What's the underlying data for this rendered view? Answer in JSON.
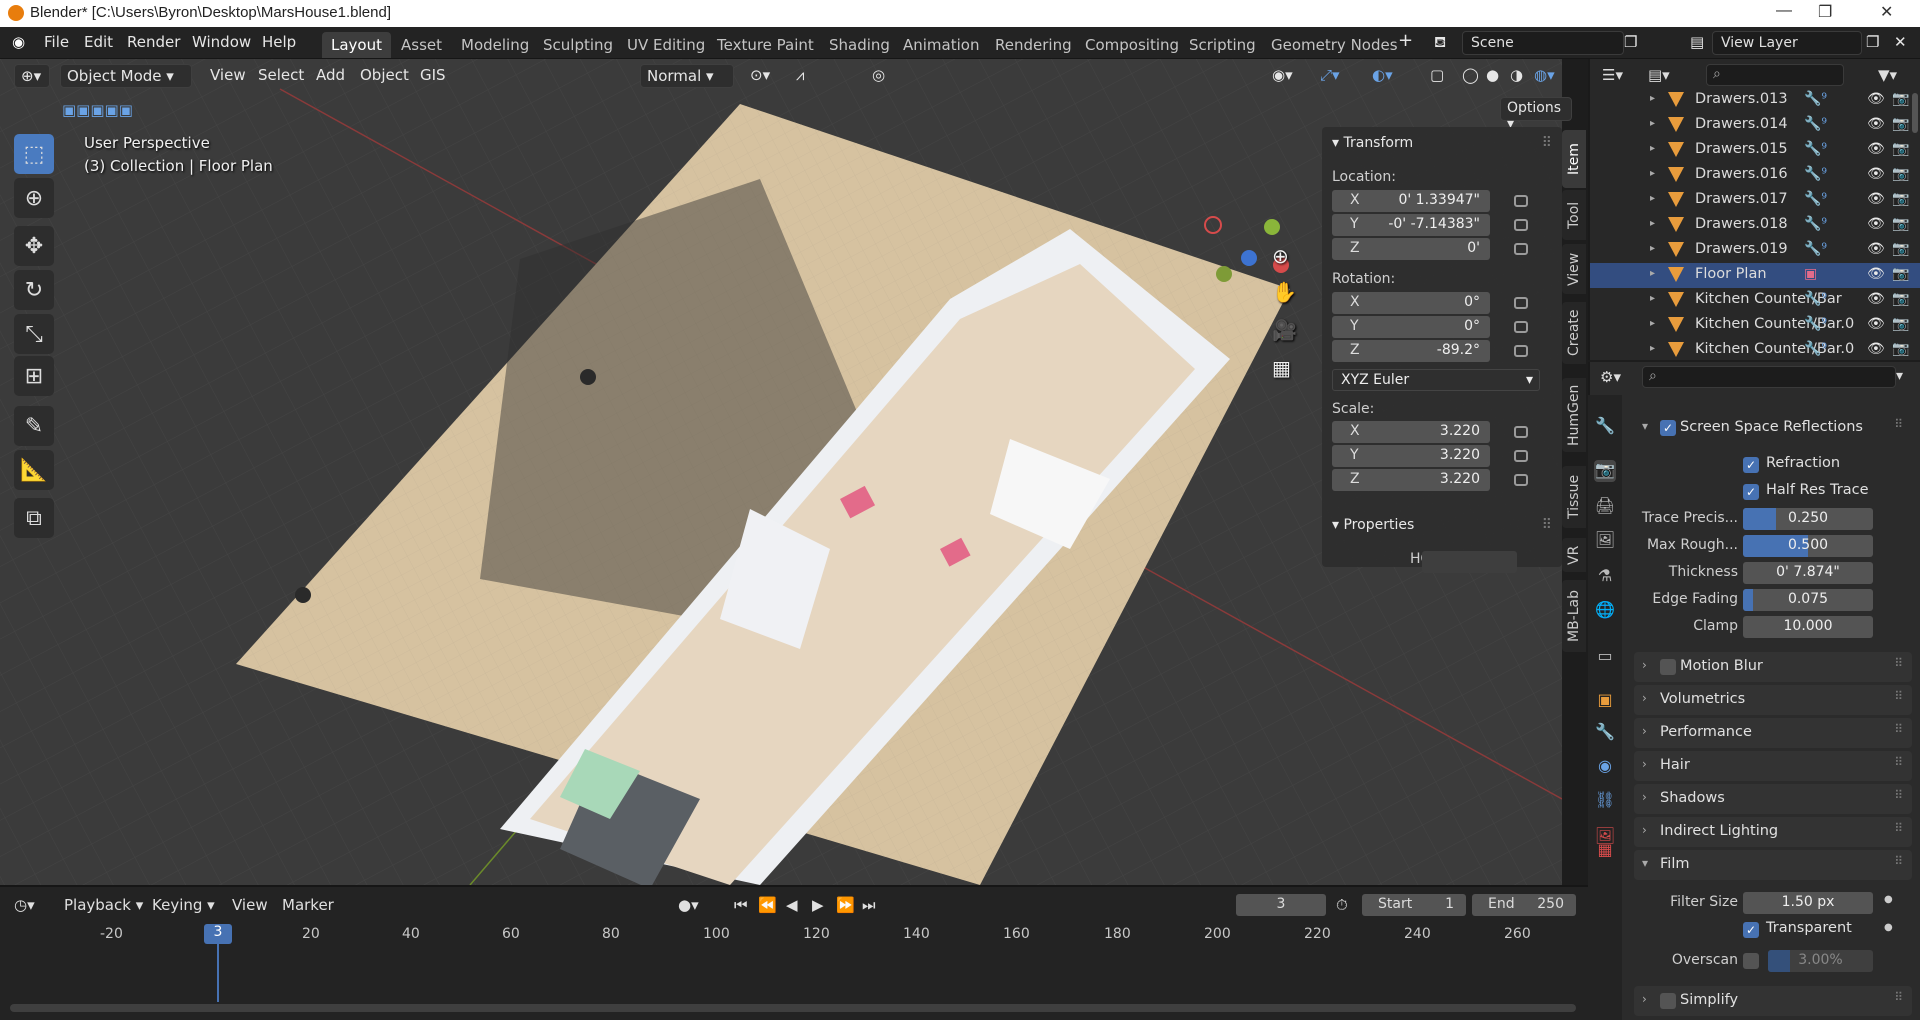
{
  "window": {
    "title": "Blender* [C:\\Users\\Byron\\Desktop\\MarsHouse1.blend]"
  },
  "menu": [
    "File",
    "Edit",
    "Render",
    "Window",
    "Help"
  ],
  "workspaces": [
    "Layout",
    "Asset",
    "Modeling",
    "Sculpting",
    "UV Editing",
    "Texture Paint",
    "Shading",
    "Animation",
    "Rendering",
    "Compositing",
    "Scripting",
    "Geometry Nodes"
  ],
  "scene": {
    "name": "Scene",
    "view_layer": "View Layer"
  },
  "viewport_header": {
    "mode": "Object Mode",
    "items": [
      "View",
      "Select",
      "Add",
      "Object",
      "GIS"
    ],
    "orientation": "Normal",
    "options": "Options"
  },
  "viewport_overlay": {
    "perspective": "User Perspective",
    "collection": "(3) Collection | Floor Plan"
  },
  "npanel": {
    "transform_title": "Transform",
    "location_label": "Location:",
    "location": {
      "x": "0' 1.33947\"",
      "y": "-0' -7.14383\"",
      "z": "0'"
    },
    "rotation_label": "Rotation:",
    "rotation": {
      "x": "0°",
      "y": "0°",
      "z": "-89.2°"
    },
    "rotation_mode": "XYZ Euler",
    "scale_label": "Scale:",
    "scale": {
      "x": "3.220",
      "y": "3.220",
      "z": "3.220"
    },
    "properties_title": "Properties",
    "hg_label": "HG",
    "axes": {
      "x": "X",
      "y": "Y",
      "z": "Z"
    }
  },
  "side_tabs": [
    "Item",
    "Tool",
    "View",
    "Create",
    "HumGen",
    "Tissue",
    "VR",
    "MB-Lab"
  ],
  "outliner": {
    "rows": [
      {
        "name": "Drawers.013",
        "selected": false
      },
      {
        "name": "Drawers.014",
        "selected": false
      },
      {
        "name": "Drawers.015",
        "selected": false
      },
      {
        "name": "Drawers.016",
        "selected": false
      },
      {
        "name": "Drawers.017",
        "selected": false
      },
      {
        "name": "Drawers.018",
        "selected": false
      },
      {
        "name": "Drawers.019",
        "selected": false
      },
      {
        "name": "Floor Plan",
        "selected": true
      },
      {
        "name": "Kitchen Counter/Bar",
        "selected": false
      },
      {
        "name": "Kitchen Counter/Bar.0",
        "selected": false
      },
      {
        "name": "Kitchen Counter/Bar.0",
        "selected": false
      }
    ]
  },
  "properties": {
    "ssr": {
      "title": "Screen Space Reflections",
      "refraction": "Refraction",
      "half_res": "Half Res Trace",
      "trace_precision_label": "Trace Precis...",
      "trace_precision": "0.250",
      "trace_precision_level": 0.25,
      "max_rough_label": "Max Rough...",
      "max_rough": "0.500",
      "max_rough_level": 0.5,
      "thickness_label": "Thickness",
      "thickness": "0' 7.874\"",
      "edge_fading_label": "Edge Fading",
      "edge_fading": "0.075",
      "edge_fading_level": 0.075,
      "clamp_label": "Clamp",
      "clamp": "10.000"
    },
    "sections": [
      "Motion Blur",
      "Volumetrics",
      "Performance",
      "Hair",
      "Shadows",
      "Indirect Lighting"
    ],
    "film": {
      "title": "Film",
      "filter_size_label": "Filter Size",
      "filter_size": "1.50 px",
      "transparent": "Transparent",
      "overscan_label": "Overscan",
      "overscan": "3.00%"
    },
    "simplify": "Simplify"
  },
  "timeline": {
    "menus": [
      "Playback",
      "Keying",
      "View",
      "Marker"
    ],
    "current_frame": "3",
    "start_label": "Start",
    "start": "1",
    "end_label": "End",
    "end": "250",
    "ticks": [
      "-20",
      "20",
      "40",
      "60",
      "80",
      "100",
      "120",
      "140",
      "160",
      "180",
      "200",
      "220",
      "240",
      "260"
    ],
    "playhead": "3"
  },
  "colors": {
    "accent": "#4772b3",
    "selection": "#334d80",
    "orange": "#e89c3c"
  }
}
